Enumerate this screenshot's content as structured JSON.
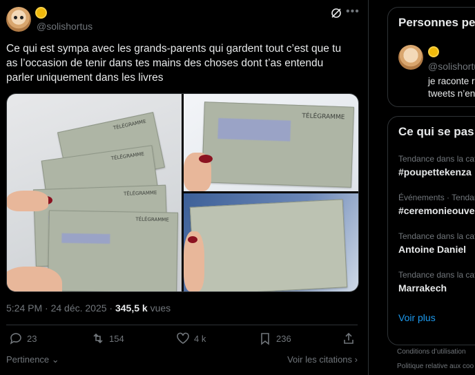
{
  "post": {
    "handle": "@solishortus",
    "text": "Ce qui est sympa avec les grands-parents qui gardent tout c’est que tu as l’occasion de tenir dans tes mains des choses dont t’as entendu parler uniquement dans les livres",
    "time": "5:24 PM · 24 déc. 2025 ·",
    "views": "345,5 k",
    "views_label": "vues",
    "image_labels": [
      "TÉLÉGRAMME",
      "TÉLÉGRAMME",
      "TÉLÉGRAMME",
      "TÉLÉGRAMME",
      "TÉLÉGRAMME"
    ],
    "actions": {
      "replies": "23",
      "reposts": "154",
      "likes": "4 k",
      "bookmarks": "236"
    },
    "sort_label": "Pertinence",
    "quotes_label": "Voir les citations"
  },
  "sidebar": {
    "people": {
      "title": "Personnes pe",
      "handle": "@solishortu",
      "bio_line1": "je raconte r",
      "bio_line2": "tweets n’en"
    },
    "trends": {
      "title": "Ce qui se pas",
      "items": [
        {
          "context": "Tendance dans la cat",
          "name": "#poupettekenza"
        },
        {
          "context": "Événements · Tendan",
          "name": "#ceremonieouver"
        },
        {
          "context": "Tendance dans la cat",
          "name": "Antoine Daniel"
        },
        {
          "context": "Tendance dans la cat",
          "name": "Marrakech"
        }
      ],
      "show_more": "Voir plus"
    },
    "footer": [
      "Conditions d’utilisation",
      "Politique relative aux coo"
    ]
  }
}
